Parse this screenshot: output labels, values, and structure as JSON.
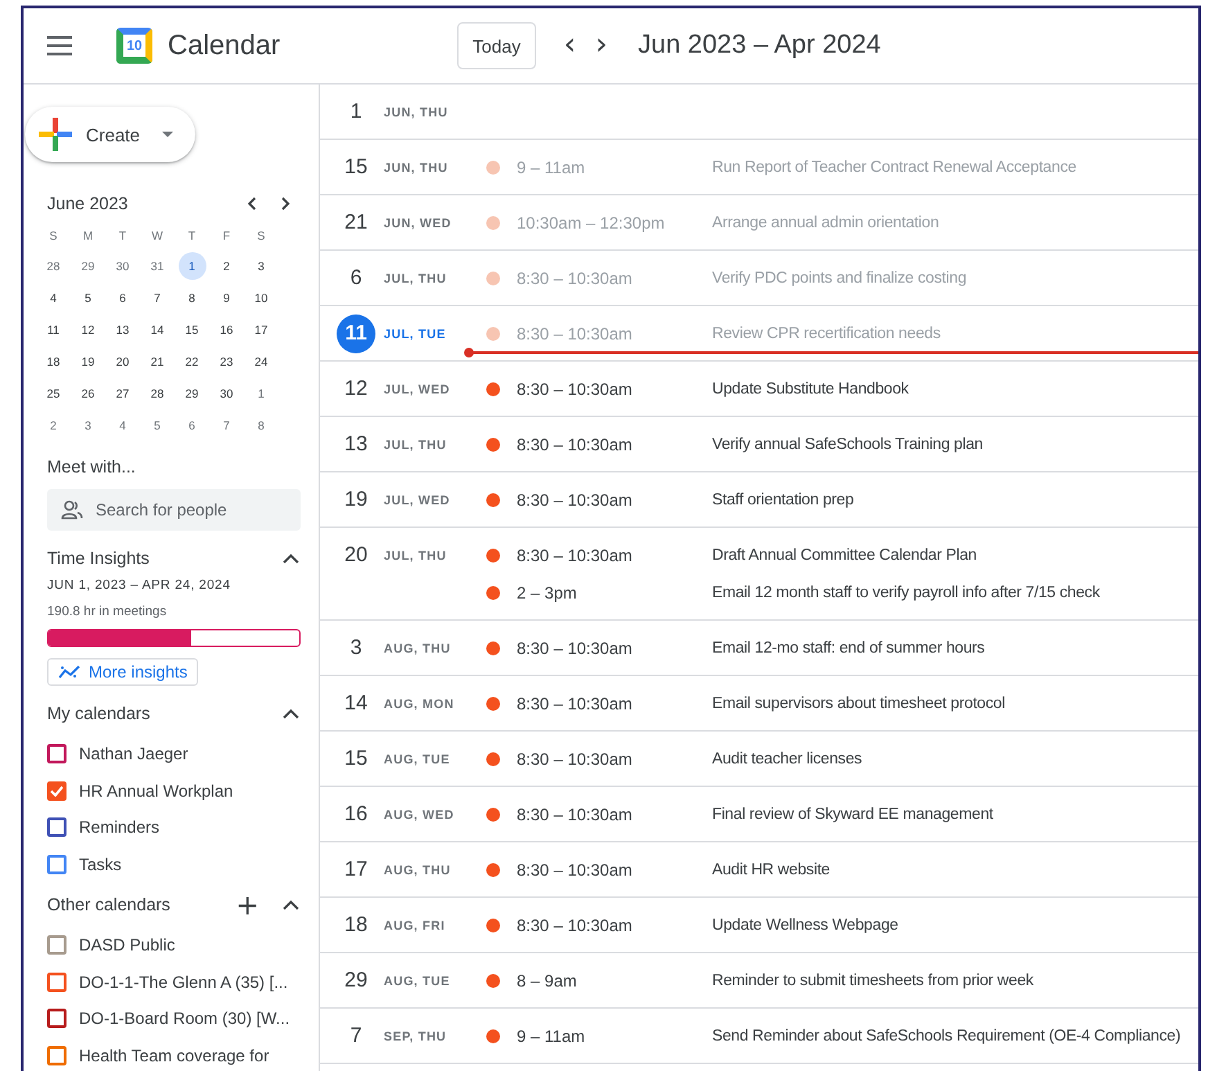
{
  "header": {
    "logo_day": "10",
    "app_title": "Calendar",
    "today_button": "Today",
    "prev": "‹",
    "next": "›",
    "range_title": "Jun 2023 – Apr 2024"
  },
  "sidebar": {
    "create_button": "Create",
    "mini_calendar": {
      "title": "June 2023",
      "weekdays": [
        "S",
        "M",
        "T",
        "W",
        "T",
        "F",
        "S"
      ],
      "weeks": [
        [
          {
            "label": "28",
            "outside": true,
            "selected": false
          },
          {
            "label": "29",
            "outside": true,
            "selected": false
          },
          {
            "label": "30",
            "outside": true,
            "selected": false
          },
          {
            "label": "31",
            "outside": true,
            "selected": false
          },
          {
            "label": "1",
            "outside": false,
            "selected": true
          },
          {
            "label": "2",
            "outside": false,
            "selected": false
          },
          {
            "label": "3",
            "outside": false,
            "selected": false
          }
        ],
        [
          {
            "label": "4",
            "outside": false,
            "selected": false
          },
          {
            "label": "5",
            "outside": false,
            "selected": false
          },
          {
            "label": "6",
            "outside": false,
            "selected": false
          },
          {
            "label": "7",
            "outside": false,
            "selected": false
          },
          {
            "label": "8",
            "outside": false,
            "selected": false
          },
          {
            "label": "9",
            "outside": false,
            "selected": false
          },
          {
            "label": "10",
            "outside": false,
            "selected": false
          }
        ],
        [
          {
            "label": "11",
            "outside": false,
            "selected": false
          },
          {
            "label": "12",
            "outside": false,
            "selected": false
          },
          {
            "label": "13",
            "outside": false,
            "selected": false
          },
          {
            "label": "14",
            "outside": false,
            "selected": false
          },
          {
            "label": "15",
            "outside": false,
            "selected": false
          },
          {
            "label": "16",
            "outside": false,
            "selected": false
          },
          {
            "label": "17",
            "outside": false,
            "selected": false
          }
        ],
        [
          {
            "label": "18",
            "outside": false,
            "selected": false
          },
          {
            "label": "19",
            "outside": false,
            "selected": false
          },
          {
            "label": "20",
            "outside": false,
            "selected": false
          },
          {
            "label": "21",
            "outside": false,
            "selected": false
          },
          {
            "label": "22",
            "outside": false,
            "selected": false
          },
          {
            "label": "23",
            "outside": false,
            "selected": false
          },
          {
            "label": "24",
            "outside": false,
            "selected": false
          }
        ],
        [
          {
            "label": "25",
            "outside": false,
            "selected": false
          },
          {
            "label": "26",
            "outside": false,
            "selected": false
          },
          {
            "label": "27",
            "outside": false,
            "selected": false
          },
          {
            "label": "28",
            "outside": false,
            "selected": false
          },
          {
            "label": "29",
            "outside": false,
            "selected": false
          },
          {
            "label": "30",
            "outside": false,
            "selected": false
          },
          {
            "label": "1",
            "outside": true,
            "selected": false
          }
        ],
        [
          {
            "label": "2",
            "outside": true,
            "selected": false
          },
          {
            "label": "3",
            "outside": true,
            "selected": false
          },
          {
            "label": "4",
            "outside": true,
            "selected": false
          },
          {
            "label": "5",
            "outside": true,
            "selected": false
          },
          {
            "label": "6",
            "outside": true,
            "selected": false
          },
          {
            "label": "7",
            "outside": true,
            "selected": false
          },
          {
            "label": "8",
            "outside": true,
            "selected": false
          }
        ]
      ]
    },
    "meet_with": {
      "title": "Meet with...",
      "search": {
        "placeholder": "Search for people"
      }
    },
    "time_insights": {
      "title": "Time Insights",
      "expanded": true,
      "range": "JUN 1, 2023 – APR 24, 2024",
      "summary": "190.8 hr in meetings",
      "level": 0.58,
      "more_button": "More insights"
    },
    "my_calendars": {
      "title": "My calendars",
      "expanded": true,
      "items": [
        {
          "label": "Nathan Jaeger",
          "checked": false,
          "color": "#c2185b"
        },
        {
          "label": "HR Annual Workplan",
          "checked": true,
          "color": "#f4511e"
        },
        {
          "label": "Reminders",
          "checked": false,
          "color": "#3f51b5"
        },
        {
          "label": "Tasks",
          "checked": false,
          "color": "#4285f4"
        }
      ]
    },
    "other_calendars": {
      "title": "Other calendars",
      "add": "+",
      "expanded": true,
      "items": [
        {
          "label": "DASD Public",
          "checked": false,
          "color": "#a79b8e"
        },
        {
          "label": "DO-1-1-The Glenn A (35) [...",
          "checked": false,
          "color": "#f4511e"
        },
        {
          "label": "DO-1-Board Room (30) [W...",
          "checked": false,
          "color": "#b71c1c"
        },
        {
          "label": "Health Team coverage for",
          "checked": false,
          "color": "#ef6c00"
        }
      ]
    }
  },
  "agenda": {
    "days": [
      {
        "day": "1",
        "date": "JUN, THU",
        "today": false
      },
      {
        "day": "15",
        "date": "JUN, THU",
        "today": false,
        "now_line": false,
        "events": [
          {
            "time": "9 – 11am",
            "title": "Run Report of Teacher Contract Renewal Acceptance",
            "past": true
          }
        ]
      },
      {
        "day": "21",
        "date": "JUN, WED",
        "today": false,
        "now_line": false,
        "events": [
          {
            "time": "10:30am – 12:30pm",
            "title": "Arrange annual admin orientation",
            "past": true
          }
        ]
      },
      {
        "day": "6",
        "date": "JUL, THU",
        "today": false,
        "now_line": false,
        "events": [
          {
            "time": "8:30 – 10:30am",
            "title": "Verify PDC points and finalize costing",
            "past": true
          }
        ]
      },
      {
        "day": "11",
        "date": "JUL, TUE",
        "today": true,
        "now_line": true,
        "events": [
          {
            "time": "8:30 – 10:30am",
            "title": "Review CPR recertification needs",
            "past": true
          }
        ]
      },
      {
        "day": "12",
        "date": "JUL, WED",
        "today": false,
        "now_line": false,
        "events": [
          {
            "time": "8:30 – 10:30am",
            "title": "Update Substitute Handbook",
            "past": false
          }
        ]
      },
      {
        "day": "13",
        "date": "JUL, THU",
        "today": false,
        "now_line": false,
        "events": [
          {
            "time": "8:30 – 10:30am",
            "title": "Verify annual SafeSchools Training plan",
            "past": false
          }
        ]
      },
      {
        "day": "19",
        "date": "JUL, WED",
        "today": false,
        "now_line": false,
        "events": [
          {
            "time": "8:30 – 10:30am",
            "title": "Staff orientation prep",
            "past": false
          }
        ]
      },
      {
        "day": "20",
        "date": "JUL, THU",
        "today": false,
        "now_line": false,
        "events": [
          {
            "time": "8:30 – 10:30am",
            "title": "Draft Annual Committee Calendar Plan",
            "past": false
          },
          {
            "time": "2 – 3pm",
            "title": "Email 12 month staff to verify payroll info after 7/15 check",
            "past": false
          }
        ]
      },
      {
        "day": "3",
        "date": "AUG, THU",
        "today": false,
        "now_line": false,
        "events": [
          {
            "time": "8:30 – 10:30am",
            "title": "Email 12-mo staff: end of summer hours",
            "past": false
          }
        ]
      },
      {
        "day": "14",
        "date": "AUG, MON",
        "today": false,
        "now_line": false,
        "events": [
          {
            "time": "8:30 – 10:30am",
            "title": "Email supervisors about timesheet protocol",
            "past": false
          }
        ]
      },
      {
        "day": "15",
        "date": "AUG, TUE",
        "today": false,
        "now_line": false,
        "events": [
          {
            "time": "8:30 – 10:30am",
            "title": "Audit teacher licenses",
            "past": false
          }
        ]
      },
      {
        "day": "16",
        "date": "AUG, WED",
        "today": false,
        "now_line": false,
        "events": [
          {
            "time": "8:30 – 10:30am",
            "title": "Final review of Skyward EE management",
            "past": false
          }
        ]
      },
      {
        "day": "17",
        "date": "AUG, THU",
        "today": false,
        "now_line": false,
        "events": [
          {
            "time": "8:30 – 10:30am",
            "title": "Audit HR website",
            "past": false
          }
        ]
      },
      {
        "day": "18",
        "date": "AUG, FRI",
        "today": false,
        "now_line": false,
        "events": [
          {
            "time": "8:30 – 10:30am",
            "title": "Update Wellness Webpage",
            "past": false
          }
        ]
      },
      {
        "day": "29",
        "date": "AUG, TUE",
        "today": false,
        "now_line": false,
        "events": [
          {
            "time": "8 – 9am",
            "title": "Reminder to submit timesheets from prior week",
            "past": false
          }
        ]
      },
      {
        "day": "7",
        "date": "SEP, THU",
        "today": false,
        "now_line": false,
        "events": [
          {
            "time": "9 – 11am",
            "title": "Send Reminder about SafeSchools Requirement (OE-4 Compliance)",
            "past": false
          }
        ]
      }
    ]
  }
}
